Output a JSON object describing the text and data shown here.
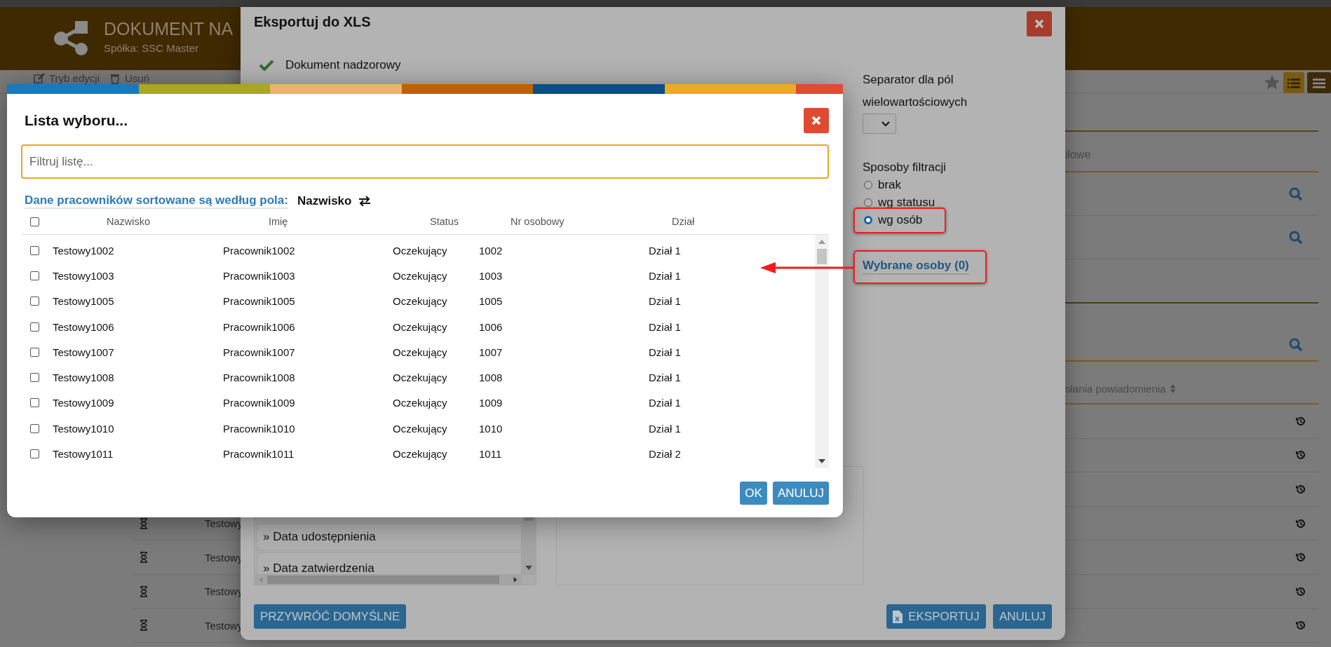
{
  "page": {
    "header": {
      "title": "DOKUMENT NA",
      "company": "Spółka: SSC Master"
    },
    "toolbar": [
      {
        "label": "Tryb edycji",
        "kind": "edit"
      },
      {
        "label": "Usuń",
        "kind": "delete"
      }
    ],
    "field_fragment": "ilowe",
    "table": {
      "header_fragment": "słania powiadomienia",
      "rows": [
        {
          "name": "Testowy"
        },
        {
          "name": "Testowy"
        },
        {
          "name": "Testowy"
        },
        {
          "name": "Testowy"
        }
      ]
    }
  },
  "export_dialog": {
    "title": "Eksportuj do XLS",
    "document": "Dokument nadzorowy",
    "separator_label": "Separator dla pól wielowartościowych",
    "filter_label": "Sposoby filtracji",
    "filter_options": [
      {
        "label": "brak",
        "selected": false
      },
      {
        "label": "wg statusu",
        "selected": false
      },
      {
        "label": "wg osób",
        "selected": true
      }
    ],
    "selected_people_link": "Wybrane osoby (0)",
    "columns_list": [
      "» Data udostępnienia",
      "» Data zatwierdzenia"
    ],
    "buttons": {
      "restore": "PRZYWRÓĆ DOMYŚLNE",
      "export": "EKSPORTUJ",
      "cancel": "ANULUJ"
    }
  },
  "picker_dialog": {
    "title": "Lista wyboru...",
    "filter": {
      "placeholder": "Filtruj listę..."
    },
    "sort_label": "Dane pracowników sortowane są według pola:",
    "sort_field": "Nazwisko",
    "select_all": {
      "checked": false
    },
    "columns": [
      "Nazwisko",
      "Imię",
      "Status",
      "Nr osobowy",
      "Dział"
    ],
    "rows": [
      {
        "checked": false,
        "cells": [
          "Testowy1002",
          "Pracownik1002",
          "Oczekujący",
          "1002",
          "Dział 1"
        ]
      },
      {
        "checked": false,
        "cells": [
          "Testowy1003",
          "Pracownik1003",
          "Oczekujący",
          "1003",
          "Dział 1"
        ]
      },
      {
        "checked": false,
        "cells": [
          "Testowy1005",
          "Pracownik1005",
          "Oczekujący",
          "1005",
          "Dział 1"
        ]
      },
      {
        "checked": false,
        "cells": [
          "Testowy1006",
          "Pracownik1006",
          "Oczekujący",
          "1006",
          "Dział 1"
        ]
      },
      {
        "checked": false,
        "cells": [
          "Testowy1007",
          "Pracownik1007",
          "Oczekujący",
          "1007",
          "Dział 1"
        ]
      },
      {
        "checked": false,
        "cells": [
          "Testowy1008",
          "Pracownik1008",
          "Oczekujący",
          "1008",
          "Dział 1"
        ]
      },
      {
        "checked": false,
        "cells": [
          "Testowy1009",
          "Pracownik1009",
          "Oczekujący",
          "1009",
          "Dział 1"
        ]
      },
      {
        "checked": false,
        "cells": [
          "Testowy1010",
          "Pracownik1010",
          "Oczekujący",
          "1010",
          "Dział 1"
        ]
      },
      {
        "checked": false,
        "cells": [
          "Testowy1011",
          "Pracownik1011",
          "Oczekujący",
          "1011",
          "Dział 2"
        ]
      }
    ],
    "buttons": {
      "ok": "OK",
      "cancel": "ANULUJ"
    }
  }
}
